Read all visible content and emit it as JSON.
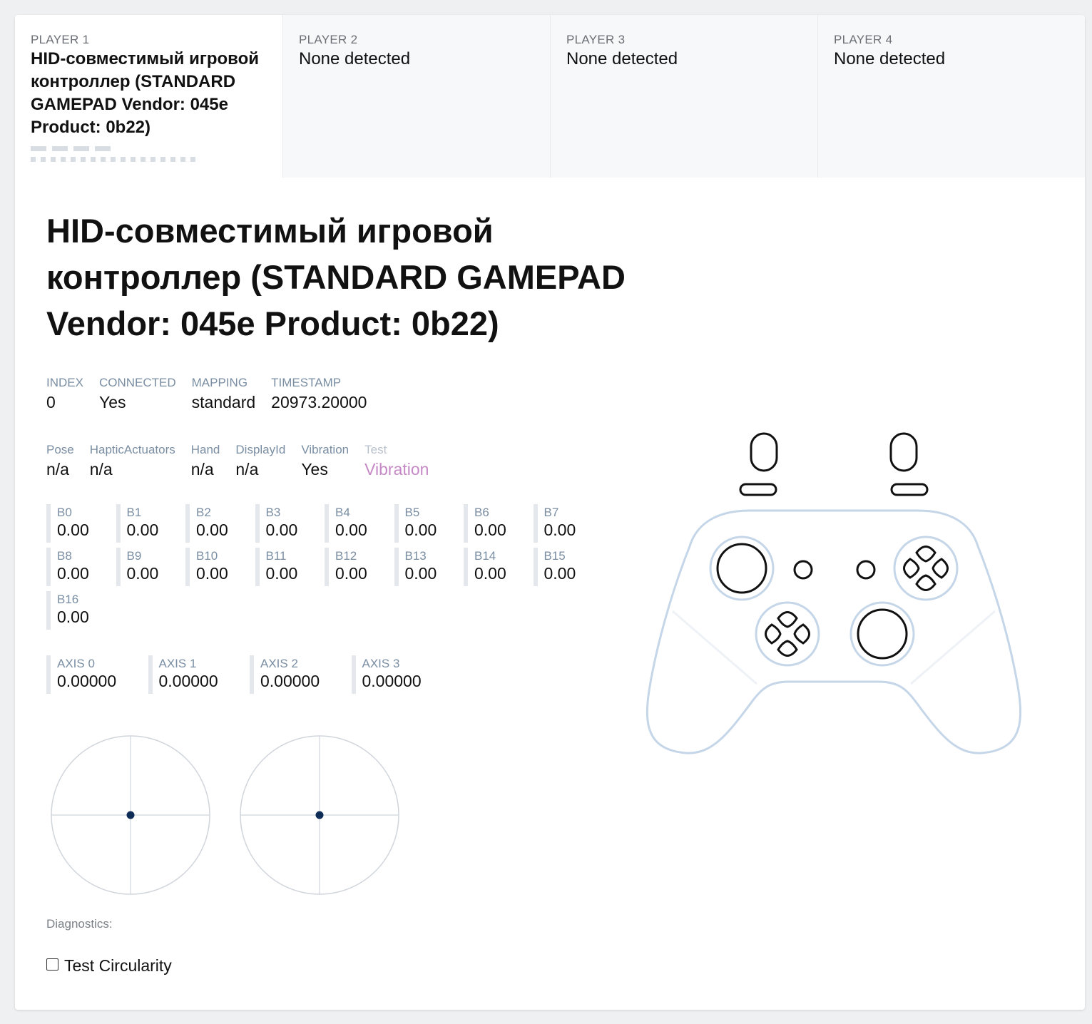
{
  "tabs": [
    {
      "label": "PLAYER 1",
      "name": "HID-совместимый игровой контроллер (STANDARD GAMEPAD Vendor: 045e Product: 0b22)"
    },
    {
      "label": "PLAYER 2",
      "name": "None detected"
    },
    {
      "label": "PLAYER 3",
      "name": "None detected"
    },
    {
      "label": "PLAYER 4",
      "name": "None detected"
    }
  ],
  "title": "HID-совместимый игровой контроллер (STANDARD GAMEPAD Vendor: 045e Product: 0b22)",
  "info": {
    "index": {
      "label": "INDEX",
      "value": "0"
    },
    "connected": {
      "label": "CONNECTED",
      "value": "Yes"
    },
    "mapping": {
      "label": "MAPPING",
      "value": "standard"
    },
    "timestamp": {
      "label": "TIMESTAMP",
      "value": "20973.20000"
    }
  },
  "extra": {
    "pose": {
      "label": "Pose",
      "value": "n/a"
    },
    "haptic": {
      "label": "HapticActuators",
      "value": "n/a"
    },
    "hand": {
      "label": "Hand",
      "value": "n/a"
    },
    "display": {
      "label": "DisplayId",
      "value": "n/a"
    },
    "vibration": {
      "label": "Vibration",
      "value": "Yes"
    },
    "test": {
      "label": "Test",
      "value": "Vibration"
    }
  },
  "buttons": [
    {
      "label": "B0",
      "value": "0.00"
    },
    {
      "label": "B1",
      "value": "0.00"
    },
    {
      "label": "B2",
      "value": "0.00"
    },
    {
      "label": "B3",
      "value": "0.00"
    },
    {
      "label": "B4",
      "value": "0.00"
    },
    {
      "label": "B5",
      "value": "0.00"
    },
    {
      "label": "B6",
      "value": "0.00"
    },
    {
      "label": "B7",
      "value": "0.00"
    },
    {
      "label": "B8",
      "value": "0.00"
    },
    {
      "label": "B9",
      "value": "0.00"
    },
    {
      "label": "B10",
      "value": "0.00"
    },
    {
      "label": "B11",
      "value": "0.00"
    },
    {
      "label": "B12",
      "value": "0.00"
    },
    {
      "label": "B13",
      "value": "0.00"
    },
    {
      "label": "B14",
      "value": "0.00"
    },
    {
      "label": "B15",
      "value": "0.00"
    },
    {
      "label": "B16",
      "value": "0.00"
    }
  ],
  "axes": [
    {
      "label": "AXIS 0",
      "value": "0.00000"
    },
    {
      "label": "AXIS 1",
      "value": "0.00000"
    },
    {
      "label": "AXIS 2",
      "value": "0.00000"
    },
    {
      "label": "AXIS 3",
      "value": "0.00000"
    }
  ],
  "diagnostics": {
    "label": "Diagnostics:",
    "checkbox_label": "Test Circularity",
    "checked": false
  },
  "colors": {
    "accent": "#c58ac5",
    "stick_dot": "#0d2d57",
    "pad_outline": "#c5d6e8"
  }
}
